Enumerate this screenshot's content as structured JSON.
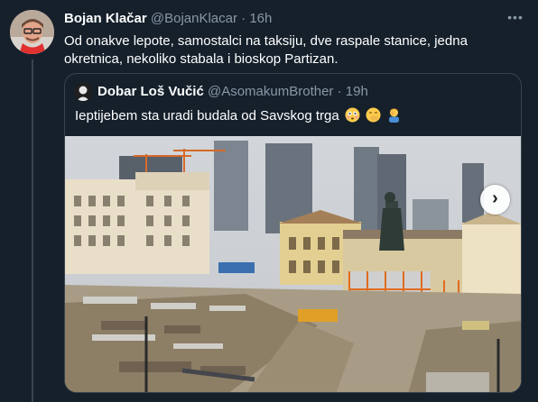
{
  "tweet": {
    "author_name": "Bojan Klačar",
    "handle": "@BojanKlacar",
    "separator": "·",
    "time": "16h",
    "more_glyph": "•••",
    "text": "Od onakve lepote, samostalci na taksiju, dve raspale stanice, jedna okretnica, nekoliko stabala i bioskop Partizan."
  },
  "quoted": {
    "author_name": "Dobar Loš Vučić",
    "handle": "@AsomakumBrother",
    "separator": "·",
    "time": "19h",
    "text": "Ieptijebem sta uradi budala od Savskog trga",
    "emojis": [
      "flushed-face",
      "face-with-hand-over-mouth",
      "man-facepalming"
    ],
    "next_glyph": "›"
  },
  "colors": {
    "background": "#15202b",
    "secondary_text": "#8899a6",
    "border": "#38444d",
    "primary_text": "#ffffff"
  }
}
